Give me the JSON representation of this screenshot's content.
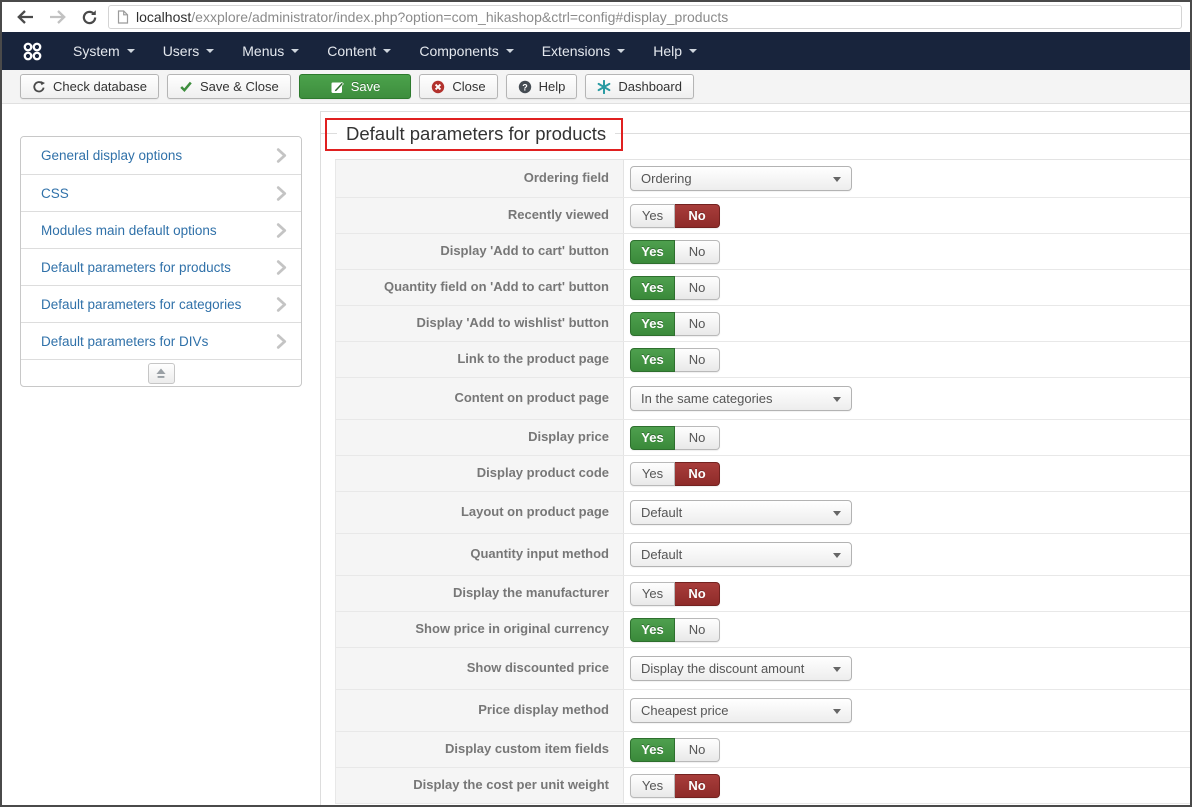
{
  "browser": {
    "url_host": "localhost",
    "url_path": "/exxplore/administrator/index.php?option=com_hikashop&ctrl=config#display_products"
  },
  "menubar": {
    "items": [
      {
        "label": "System"
      },
      {
        "label": "Users"
      },
      {
        "label": "Menus"
      },
      {
        "label": "Content"
      },
      {
        "label": "Components"
      },
      {
        "label": "Extensions"
      },
      {
        "label": "Help"
      }
    ]
  },
  "toolbar": {
    "buttons": [
      {
        "label": "Check database",
        "icon": "database-refresh-icon",
        "style": "default"
      },
      {
        "label": "Save & Close",
        "icon": "check-icon",
        "style": "default"
      },
      {
        "label": "Save",
        "icon": "apply-icon",
        "style": "success"
      },
      {
        "label": "Close",
        "icon": "close-icon",
        "style": "default"
      },
      {
        "label": "Help",
        "icon": "help-icon",
        "style": "default"
      },
      {
        "label": "Dashboard",
        "icon": "dashboard-icon",
        "style": "default"
      }
    ]
  },
  "sidebar": {
    "items": [
      {
        "label": "General display options"
      },
      {
        "label": "CSS"
      },
      {
        "label": "Modules main default options"
      },
      {
        "label": "Default parameters for products"
      },
      {
        "label": "Default parameters for categories"
      },
      {
        "label": "Default parameters for DIVs"
      }
    ]
  },
  "main": {
    "legend": "Default parameters for products",
    "toggle_labels": {
      "yes": "Yes",
      "no": "No"
    },
    "rows": [
      {
        "label": "Ordering field",
        "type": "select",
        "value": "Ordering",
        "first": true
      },
      {
        "label": "Recently viewed",
        "type": "toggle",
        "state": "no"
      },
      {
        "label": "Display 'Add to cart' button",
        "type": "toggle",
        "state": "yes"
      },
      {
        "label": "Quantity field on 'Add to cart' button",
        "type": "toggle",
        "state": "yes"
      },
      {
        "label": "Display 'Add to wishlist' button",
        "type": "toggle",
        "state": "yes"
      },
      {
        "label": "Link to the product page",
        "type": "toggle",
        "state": "yes"
      },
      {
        "label": "Content on product page",
        "type": "select",
        "value": "In the same categories"
      },
      {
        "label": "Display price",
        "type": "toggle",
        "state": "yes"
      },
      {
        "label": "Display product code",
        "type": "toggle",
        "state": "no"
      },
      {
        "label": "Layout on product page",
        "type": "select",
        "value": "Default"
      },
      {
        "label": "Quantity input method",
        "type": "select",
        "value": "Default"
      },
      {
        "label": "Display the manufacturer",
        "type": "toggle",
        "state": "no"
      },
      {
        "label": "Show price in original currency",
        "type": "toggle",
        "state": "yes"
      },
      {
        "label": "Show discounted price",
        "type": "select",
        "value": "Display the discount amount"
      },
      {
        "label": "Price display method",
        "type": "select",
        "value": "Cheapest price"
      },
      {
        "label": "Display custom item fields",
        "type": "toggle",
        "state": "yes"
      },
      {
        "label": "Display the cost per unit weight",
        "type": "toggle",
        "state": "no"
      }
    ]
  },
  "colors": {
    "navbar": "#18243c",
    "toggle_green": "#3e8e3e",
    "toggle_red": "#8e2b29",
    "link_blue": "#3071a9",
    "highlight_red": "#e02020"
  }
}
